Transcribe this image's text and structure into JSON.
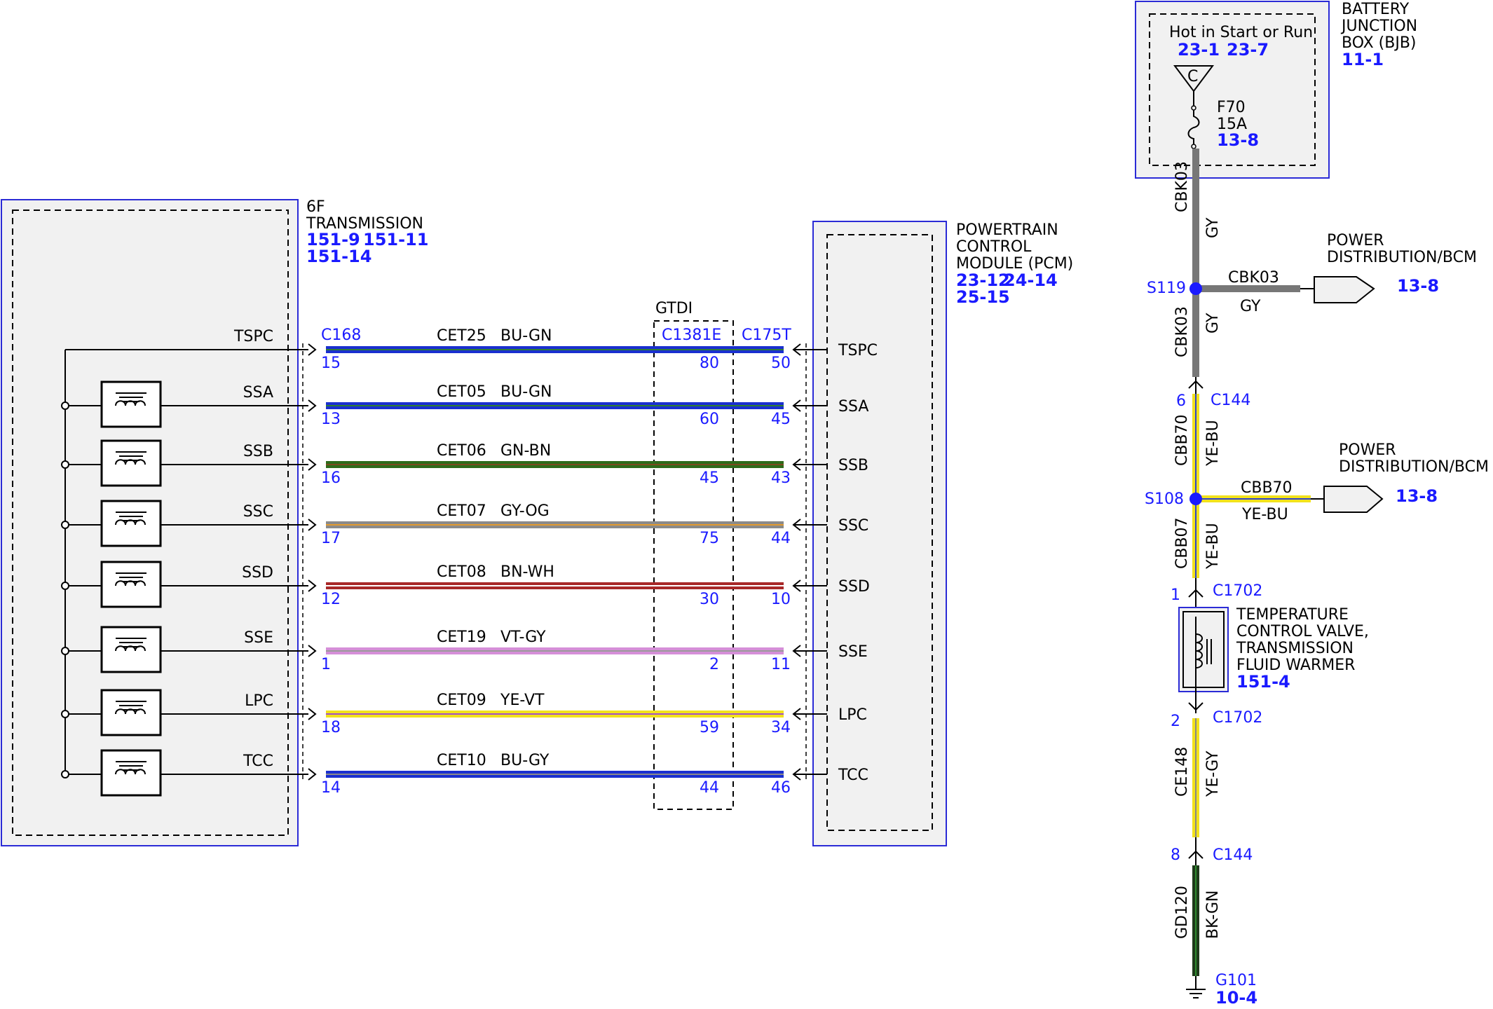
{
  "transmission": {
    "title_line1": "6F",
    "title_line2": "TRANSMISSION",
    "refs_line1": [
      "151-9",
      "151-11"
    ],
    "refs_line2": "151-14"
  },
  "pcm": {
    "title_line1": "POWERTRAIN",
    "title_line2": "CONTROL",
    "title_line3": "MODULE (PCM)",
    "refs_line1": [
      "23-12",
      "24-14"
    ],
    "refs_line2": "25-15"
  },
  "connectors": {
    "left": "C168",
    "middle_group": "GTDI",
    "middle": "C1381E",
    "right": "C175T"
  },
  "circuits": [
    {
      "signal": "TSPC",
      "circuit": "CET25",
      "color_code": "BU-GN",
      "pin_left": "15",
      "pin_mid": "80",
      "pin_right": "50",
      "pcm_pin": "TSPC",
      "solenoid": false,
      "wire_color": "#1a2fd0",
      "stripe_color": "#2e7d32"
    },
    {
      "signal": "SSA",
      "circuit": "CET05",
      "color_code": "BU-GN",
      "pin_left": "13",
      "pin_mid": "60",
      "pin_right": "45",
      "pcm_pin": "SSA",
      "solenoid": true,
      "wire_color": "#1a2fd0",
      "stripe_color": "#2e7d32"
    },
    {
      "signal": "SSB",
      "circuit": "CET06",
      "color_code": "GN-BN",
      "pin_left": "16",
      "pin_mid": "45",
      "pin_right": "43",
      "pcm_pin": "SSB",
      "solenoid": true,
      "wire_color": "#2e6b1a",
      "stripe_color": "#7a4a1e"
    },
    {
      "signal": "SSC",
      "circuit": "CET07",
      "color_code": "GY-OG",
      "pin_left": "17",
      "pin_mid": "75",
      "pin_right": "44",
      "pcm_pin": "SSC",
      "solenoid": true,
      "wire_color": "#8a8a8a",
      "stripe_color": "#e39a2e"
    },
    {
      "signal": "SSD",
      "circuit": "CET08",
      "color_code": "BN-WH",
      "pin_left": "12",
      "pin_mid": "30",
      "pin_right": "10",
      "pcm_pin": "SSD",
      "solenoid": true,
      "wire_color": "#a82828",
      "stripe_color": "#ffffff"
    },
    {
      "signal": "SSE",
      "circuit": "CET19",
      "color_code": "VT-GY",
      "pin_left": "1",
      "pin_mid": "2",
      "pin_right": "11",
      "pcm_pin": "SSE",
      "solenoid": true,
      "wire_color": "#d58fd8",
      "stripe_color": "#9a9a9a"
    },
    {
      "signal": "LPC",
      "circuit": "CET09",
      "color_code": "YE-VT",
      "pin_left": "18",
      "pin_mid": "59",
      "pin_right": "34",
      "pcm_pin": "LPC",
      "solenoid": true,
      "wire_color": "#f2e21c",
      "stripe_color": "#a050c8"
    },
    {
      "signal": "TCC",
      "circuit": "CET10",
      "color_code": "BU-GY",
      "pin_left": "14",
      "pin_mid": "44",
      "pin_right": "46",
      "pcm_pin": "TCC",
      "solenoid": true,
      "wire_color": "#1a2fd0",
      "stripe_color": "#8a8a8a"
    }
  ],
  "bjb": {
    "title_line1": "BATTERY",
    "title_line2": "JUNCTION",
    "title_line3": "BOX (BJB)",
    "ref": "11-1",
    "hot_label": "Hot in Start or Run",
    "hot_refs": [
      "23-1",
      "23-7"
    ],
    "bus": "C",
    "fuse": "F70",
    "fuse_rating": "15A",
    "fuse_ref": "13-8"
  },
  "vertical_circuit": {
    "seg1_circuit": "CBK03",
    "seg1_color": "GY",
    "splice1": "S119",
    "branch1_circuit": "CBK03",
    "branch1_color": "GY",
    "branch1_dest_line1": "POWER",
    "branch1_dest_line2": "DISTRIBUTION/BCM",
    "branch1_ref": "13-8",
    "seg2_circuit": "CBK03",
    "seg2_color": "GY",
    "conn1_pin": "6",
    "conn1": "C144",
    "seg3_circuit": "CBB70",
    "seg3_color": "YE-BU",
    "splice2": "S108",
    "branch2_circuit": "CBB70",
    "branch2_color": "YE-BU",
    "branch2_dest_line1": "POWER",
    "branch2_dest_line2": "DISTRIBUTION/BCM",
    "branch2_ref": "13-8",
    "seg4_circuit": "CBB07",
    "seg4_color": "YE-BU",
    "conn2_pin": "1",
    "conn2": "C1702",
    "valve_line1": "TEMPERATURE",
    "valve_line2": "CONTROL VALVE,",
    "valve_line3": "TRANSMISSION",
    "valve_line4": "FLUID WARMER",
    "valve_ref": "151-4",
    "conn3_pin": "2",
    "conn3": "C1702",
    "seg5_circuit": "CE148",
    "seg5_color": "YE-GY",
    "conn4_pin": "8",
    "conn4": "C144",
    "seg6_circuit": "GD120",
    "seg6_color": "BK-GN",
    "ground": "G101",
    "ground_ref": "10-4"
  },
  "colors": {
    "link_blue": "#1a1aff",
    "box_border": "#2b2bd6",
    "box_fill": "#f1f1f1",
    "gray_wire": "#777777",
    "yellow_wire": "#f2e21c",
    "black_green_wire": "#1e3a1a"
  }
}
